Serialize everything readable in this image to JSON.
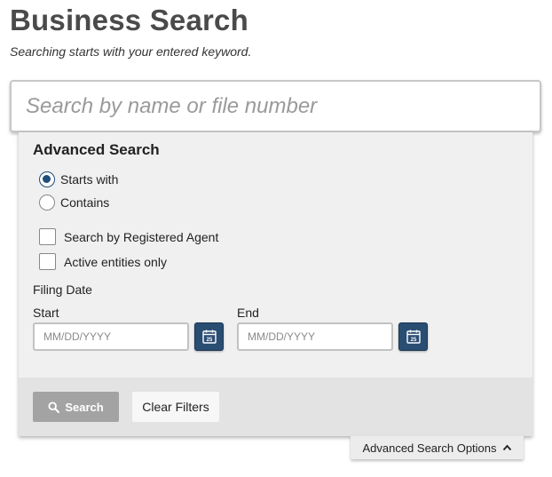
{
  "header": {
    "title": "Business Search",
    "subtitle": "Searching starts with your entered keyword."
  },
  "search": {
    "placeholder": "Search by name or file number",
    "value": ""
  },
  "advanced": {
    "title": "Advanced Search",
    "match_options": [
      {
        "label": "Starts with",
        "selected": true
      },
      {
        "label": "Contains",
        "selected": false
      }
    ],
    "checkboxes": [
      {
        "label": "Search by Registered Agent",
        "checked": false
      },
      {
        "label": "Active entities only",
        "checked": false
      }
    ],
    "filing_date": {
      "label": "Filing Date",
      "start": {
        "label": "Start",
        "placeholder": "MM/DD/YYYY",
        "value": ""
      },
      "end": {
        "label": "End",
        "placeholder": "MM/DD/YYYY",
        "value": ""
      },
      "calendar_icon": "calendar-icon",
      "calendar_day": "25"
    }
  },
  "footer": {
    "search_label": "Search",
    "search_icon": "search-icon",
    "clear_label": "Clear Filters"
  },
  "toggle": {
    "label": "Advanced Search Options",
    "icon": "chevron-up-icon"
  },
  "colors": {
    "primary": "#2a4d72",
    "search_button_disabled": "#a3a3a3",
    "panel_bg": "#f0f0f0",
    "footer_bg": "#e3e3e3"
  }
}
